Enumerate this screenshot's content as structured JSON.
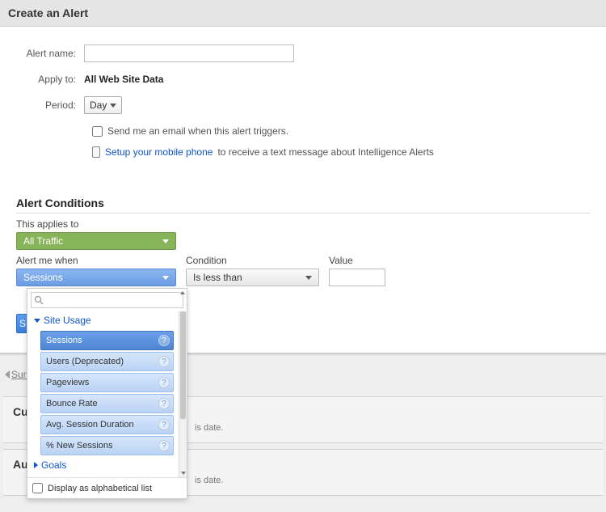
{
  "header": {
    "title": "Create an Alert"
  },
  "form": {
    "alert_name_label": "Alert name:",
    "alert_name_value": "",
    "apply_to_label": "Apply to:",
    "apply_to_value": "All Web Site Data",
    "period_label": "Period:",
    "period_value": "Day",
    "email_checkbox_label": "Send me an email when this alert triggers.",
    "phone_link": "Setup your mobile phone",
    "phone_suffix": " to receive a text message about Intelligence Alerts"
  },
  "conditions": {
    "heading": "Alert Conditions",
    "applies_label": "This applies to",
    "applies_value": "All Traffic",
    "alert_when_label": "Alert me when",
    "alert_when_value": "Sessions",
    "condition_label": "Condition",
    "condition_value": "Is less than",
    "value_label": "Value",
    "value_value": ""
  },
  "metric_picker": {
    "search_placeholder": "",
    "group_open": "Site Usage",
    "items": [
      {
        "label": "Sessions",
        "selected": true
      },
      {
        "label": "Users (Deprecated)",
        "selected": false
      },
      {
        "label": "Pageviews",
        "selected": false
      },
      {
        "label": "Bounce Rate",
        "selected": false
      },
      {
        "label": "Avg. Session Duration",
        "selected": false
      },
      {
        "label": "% New Sessions",
        "selected": false
      }
    ],
    "group_collapsed": "Goals",
    "footer_checkbox": "Display as alphabetical list"
  },
  "peek_button": "S",
  "breadcrumb": "Sun",
  "panels": {
    "custom_heading_prefix": "Cus",
    "auto_heading_prefix": "Aut",
    "note": "is date."
  }
}
